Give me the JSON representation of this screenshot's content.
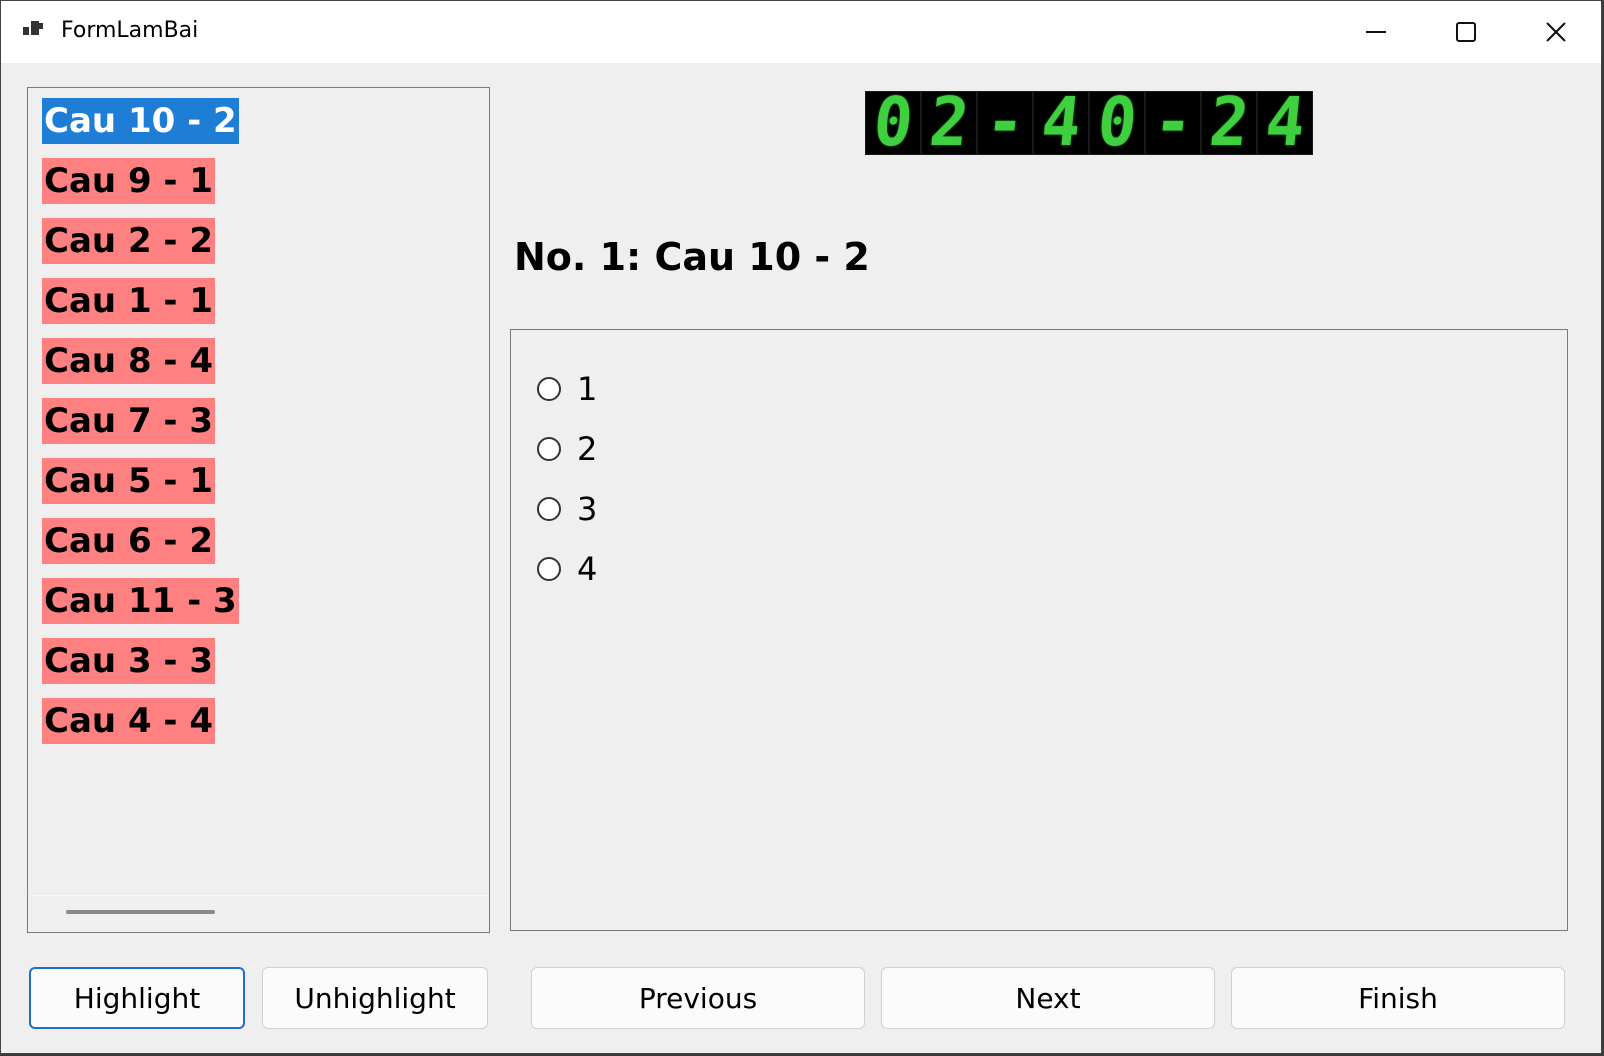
{
  "window": {
    "title": "FormLamBai"
  },
  "question_list": {
    "selected_index": 0,
    "items": [
      "Cau 10 - 2",
      "Cau 9 - 1",
      "Cau 2 - 2",
      "Cau 1 - 1",
      "Cau 8 - 4",
      "Cau 7 - 3",
      "Cau 5 - 1",
      "Cau 6 - 2",
      "Cau 11 - 3",
      "Cau 3 - 3",
      "Cau 4 - 4"
    ]
  },
  "timer": {
    "digits": [
      "0",
      "2",
      "-",
      "4",
      "0",
      "-",
      "2",
      "4"
    ]
  },
  "question": {
    "title": "No. 1: Cau 10 - 2",
    "options": [
      "1",
      "2",
      "3",
      "4"
    ]
  },
  "buttons": {
    "highlight": "Highlight",
    "unhighlight": "Unhighlight",
    "previous": "Previous",
    "next": "Next",
    "finish": "Finish"
  }
}
